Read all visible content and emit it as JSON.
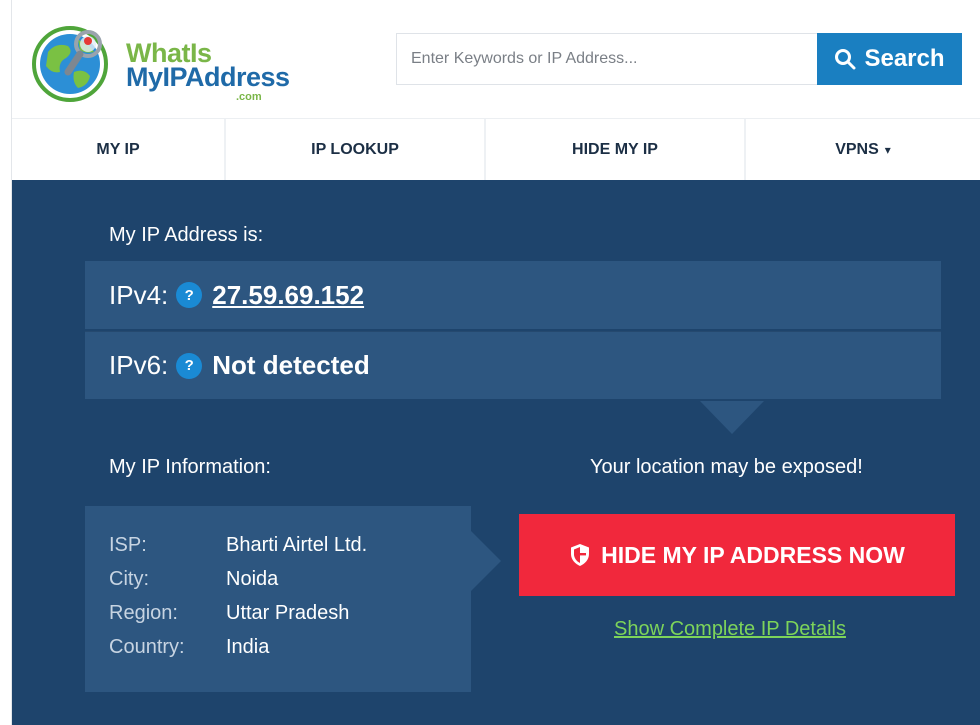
{
  "header": {
    "logo_line1": "WhatIs",
    "logo_line2": "MyIPAddress",
    "logo_suffix": ".com",
    "search_placeholder": "Enter Keywords or IP Address...",
    "search_button_label": "Search"
  },
  "nav": {
    "items": [
      {
        "label": "MY IP"
      },
      {
        "label": "IP LOOKUP"
      },
      {
        "label": "HIDE MY IP"
      },
      {
        "label": "VPNS"
      }
    ],
    "dropdown_caret": "▾"
  },
  "main": {
    "ip_heading": "My IP Address is:",
    "ipv4_label": "IPv4:",
    "ipv4_value": "27.59.69.152",
    "ipv6_label": "IPv6:",
    "ipv6_value": "Not detected",
    "help_glyph": "?",
    "info_heading": "My IP Information:",
    "info": [
      {
        "key": "ISP:",
        "value": "Bharti Airtel Ltd."
      },
      {
        "key": "City:",
        "value": "Noida"
      },
      {
        "key": "Region:",
        "value": "Uttar Pradesh"
      },
      {
        "key": "Country:",
        "value": "India"
      }
    ],
    "warning_text": "Your location may be exposed!",
    "hide_button_label": "HIDE MY IP ADDRESS NOW",
    "details_link_label": "Show Complete IP Details"
  },
  "colors": {
    "brand_blue": "#1a7fc1",
    "panel_bg": "#1e446c",
    "row_bg": "#2d5680",
    "cta_red": "#f1283c",
    "link_green": "#7dd45a",
    "logo_green": "#7ab648",
    "logo_blue": "#1f6aa8"
  },
  "icons": [
    "globe-magnifier-icon",
    "search-icon",
    "help-icon",
    "shield-icon",
    "caret-down-icon"
  ]
}
